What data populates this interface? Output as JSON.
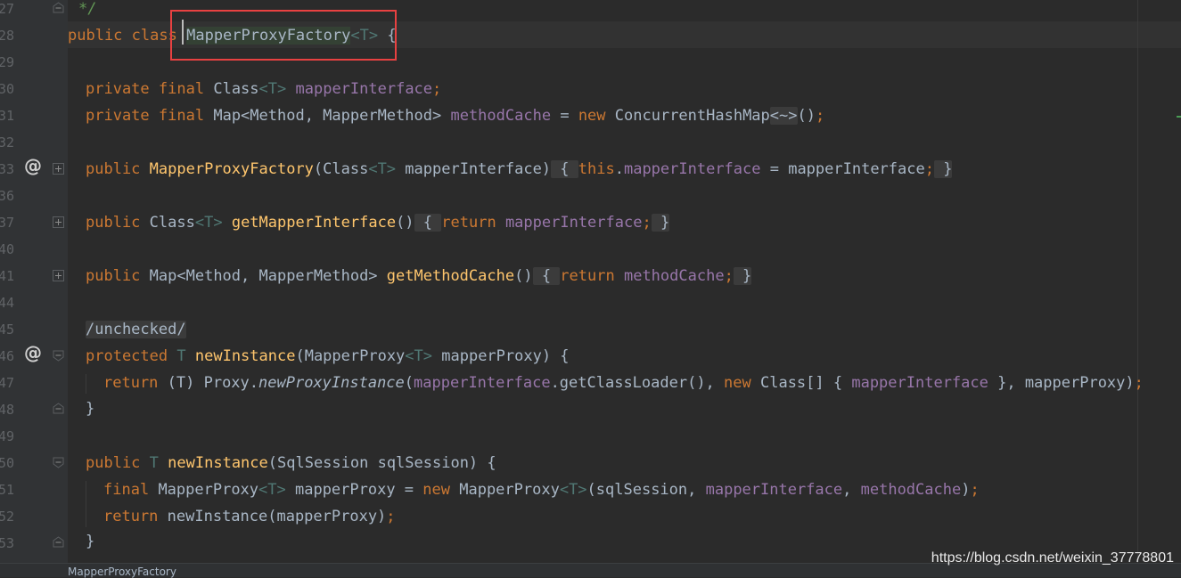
{
  "gutter": {
    "line_numbers": [
      "27",
      "28",
      "29",
      "30",
      "31",
      "32",
      "33",
      "36",
      "37",
      "40",
      "41",
      "44",
      "45",
      "46",
      "47",
      "48",
      "49",
      "50",
      "51",
      "52",
      "53"
    ]
  },
  "code": {
    "line_comment": "*/",
    "class_decl": {
      "kw1": "public",
      "kw2": "class",
      "name": "MapperProxyFactory",
      "type_param": "<T>",
      "brace": "{"
    },
    "field1": {
      "kw1": "private",
      "kw2": "final",
      "type": "Class",
      "tp": "<T>",
      "name": "mapperInterface",
      "semi": ";"
    },
    "field2": {
      "kw1": "private",
      "kw2": "final",
      "type": "Map<Method, MapperMethod>",
      "name": "methodCache",
      "eq": "=",
      "kw_new": "new",
      "ctor": "ConcurrentHashMap",
      "diamond": "<~>",
      "rest": "()",
      "semi": ";"
    },
    "ctor": {
      "kw": "public",
      "name": "MapperProxyFactory",
      "params_open": "(Class",
      "tp": "<T>",
      "param": " mapperInterface)",
      "body_open": " { ",
      "this": "this",
      "dot": ".",
      "field": "mapperInterface",
      "eq": " = mapperInterface",
      "semi": ";",
      "body_close": " }"
    },
    "getter1": {
      "kw": "public",
      "type": "Class",
      "tp": "<T>",
      "name": "getMapperInterface",
      "parens": "()",
      "body_open": " { ",
      "ret": "return",
      "field": "mapperInterface",
      "semi": ";",
      "body_close": " }"
    },
    "getter2": {
      "kw": "public",
      "type": "Map<Method, MapperMethod>",
      "name": "getMethodCache",
      "parens": "()",
      "body_open": " { ",
      "ret": "return",
      "field": "methodCache",
      "semi": ";",
      "body_close": " }"
    },
    "annotation": "/unchecked/",
    "m1": {
      "kw": "protected",
      "tp": "T",
      "name": "newInstance",
      "params": "(MapperProxy",
      "tp2": "<T>",
      "param": " mapperProxy) {"
    },
    "m1_body": {
      "ret": "return",
      "cast": " (T) Proxy.",
      "call": "newProxyInstance",
      "a1": "(",
      "f1": "mapperInterface",
      "a2": ".getClassLoader(), ",
      "kw_new": "new",
      "a3": " Class[] { ",
      "f2": "mapperInterface",
      "a4": " }, mapperProxy)",
      "semi": ";"
    },
    "close1": "}",
    "m2": {
      "kw": "public",
      "tp": "T",
      "name": "newInstance",
      "params": "(SqlSession sqlSession) {"
    },
    "m2_l1": {
      "kw": "final",
      "type": "MapperProxy",
      "tp": "<T>",
      "var": " mapperProxy = ",
      "kw_new": "new",
      "ctor": " MapperProxy",
      "tp2": "<T>",
      "a1": "(sqlSession, ",
      "f1": "mapperInterface",
      "a2": ", ",
      "f2": "methodCache",
      "a3": ")",
      "semi": ";"
    },
    "m2_l2": {
      "ret": "return",
      "rest": " newInstance(mapperProxy)",
      "semi": ";"
    },
    "close2": "}"
  },
  "breadcrumb": "MapperProxyFactory",
  "watermark": "https://blog.csdn.net/weixin_37778801",
  "colors": {
    "keyword": "#cc7832",
    "field": "#9876aa",
    "method": "#ffc66d",
    "type_param": "#507874",
    "text": "#a9b7c6",
    "highlight_box": "#e84141"
  }
}
